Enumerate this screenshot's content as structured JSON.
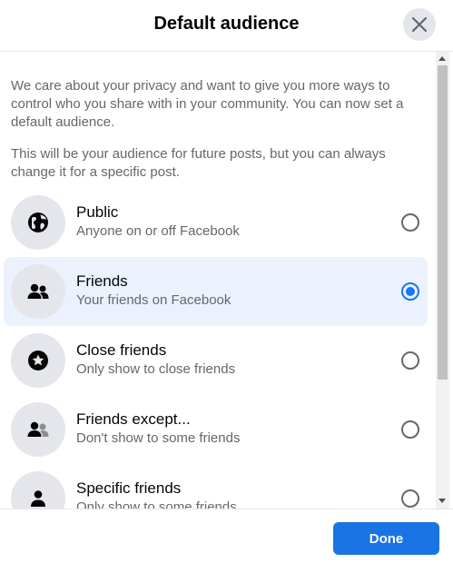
{
  "dialog": {
    "title": "Default audience",
    "close_icon": "close-icon"
  },
  "intro": {
    "paragraph_1": "We care about your privacy and want to give you more ways to control who you share with in your community. You can now set a default audience.",
    "paragraph_2": "This will be your audience for future posts, but you can always change it for a specific post."
  },
  "options": [
    {
      "title": "Public",
      "subtitle": "Anyone on or off Facebook",
      "icon": "globe-icon",
      "selected": false
    },
    {
      "title": "Friends",
      "subtitle": "Your friends on Facebook",
      "icon": "friends-icon",
      "selected": true
    },
    {
      "title": "Close friends",
      "subtitle": "Only show to close friends",
      "icon": "star-icon",
      "selected": false
    },
    {
      "title": "Friends except...",
      "subtitle": "Don't show to some friends",
      "icon": "friends-except-icon",
      "selected": false
    },
    {
      "title": "Specific friends",
      "subtitle": "Only show to some friends",
      "icon": "person-icon",
      "selected": false
    }
  ],
  "footer": {
    "done_label": "Done"
  },
  "colors": {
    "accent": "#1b74e4",
    "radio_selected": "#1877f2",
    "selected_row_bg": "#ebf2fd",
    "secondary_text": "#65676b"
  }
}
